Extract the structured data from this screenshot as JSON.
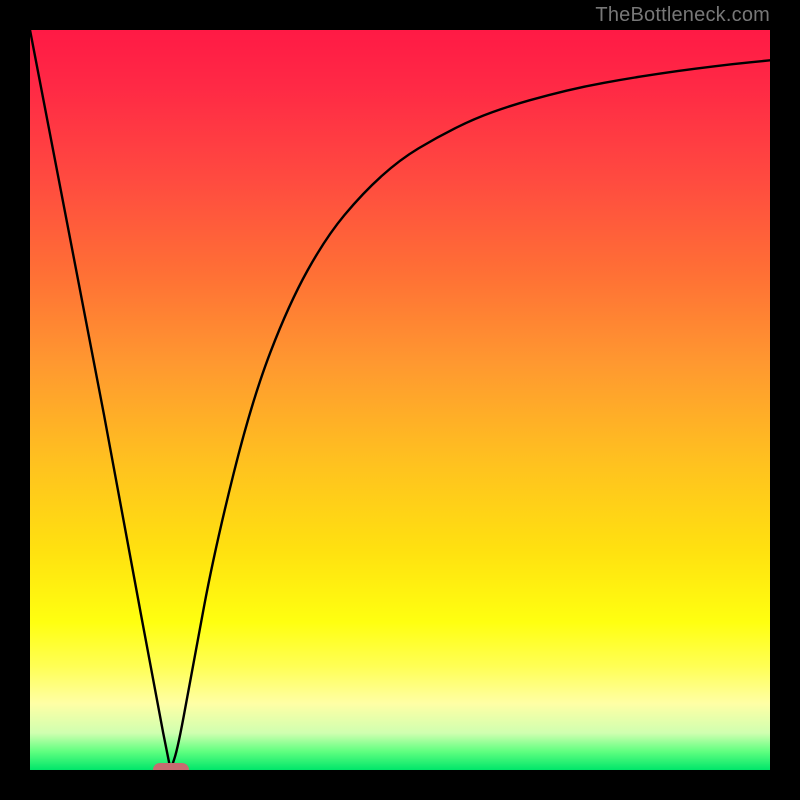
{
  "watermark": "TheBottleneck.com",
  "chart_data": {
    "type": "line",
    "title": "",
    "xlabel": "",
    "ylabel": "",
    "xlim": [
      0,
      100
    ],
    "ylim": [
      0,
      100
    ],
    "grid": false,
    "series": [
      {
        "name": "bottleneck-curve",
        "x": [
          0,
          5,
          10,
          15,
          18,
          19,
          20,
          22,
          25,
          30,
          35,
          40,
          45,
          50,
          55,
          60,
          65,
          70,
          75,
          80,
          85,
          90,
          95,
          100
        ],
        "values": [
          100,
          74,
          48,
          21,
          5,
          0,
          3,
          14,
          30,
          50,
          63,
          72,
          78,
          82.5,
          85.5,
          88,
          89.8,
          91.2,
          92.4,
          93.3,
          94.1,
          94.8,
          95.4,
          95.9
        ]
      }
    ],
    "optimum_marker": {
      "x": 19,
      "y": 0
    },
    "colors": {
      "curve": "#000000",
      "marker": "#c76b70",
      "gradient_top": "#ff1a45",
      "gradient_mid": "#ffff10",
      "gradient_bot": "#00e66a"
    }
  }
}
